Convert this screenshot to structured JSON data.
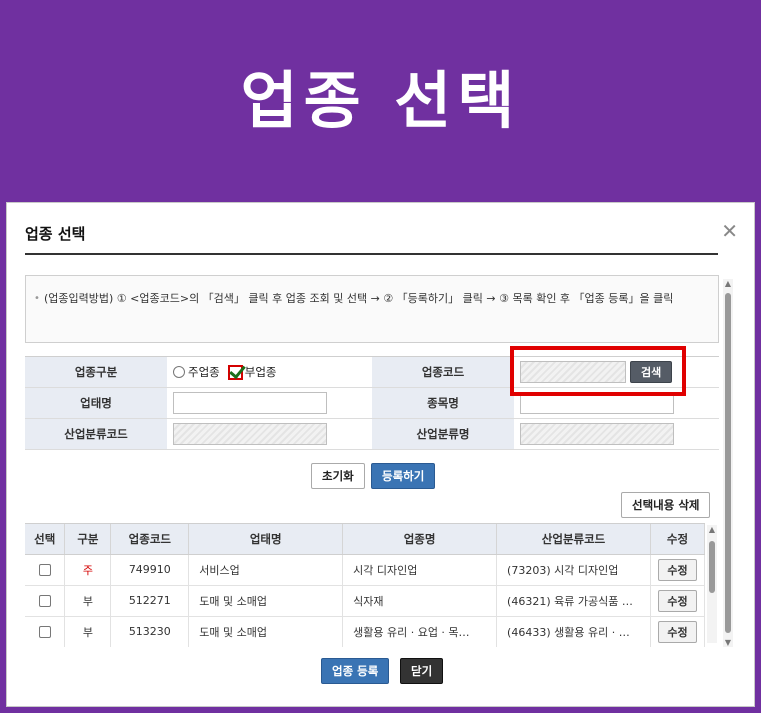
{
  "banner": {
    "title": "업종 선택"
  },
  "dialog": {
    "title": "업종 선택",
    "close_glyph": "✕",
    "guide_text": "(업종입력방법) ① <업종코드>의 「검색」 클릭 후 업종 조회 및 선택 → ② 「등록하기」 클릭 → ③ 목록 확인 후 「업종 등록」을 클릭"
  },
  "form": {
    "type_label": "업종구분",
    "radio_main_label": "주업종",
    "check_sub_label": "부업종",
    "code_label": "업종코드",
    "search_label": "검색",
    "biz_type_label": "업태명",
    "item_label": "종목명",
    "ind_code_label": "산업분류코드",
    "ind_name_label": "산업분류명",
    "code_value": "",
    "biz_type_value": "",
    "item_value": ""
  },
  "actions": {
    "reset_label": "초기화",
    "register_label": "등록하기",
    "delete_selected_label": "선택내용 삭제",
    "submit_label": "업종 등록",
    "close_label": "닫기"
  },
  "table": {
    "headers": [
      "선택",
      "구분",
      "업종코드",
      "업태명",
      "업종명",
      "산업분류코드",
      "수정"
    ],
    "edit_label": "수정",
    "rows": [
      {
        "type": "주",
        "code": "749910",
        "biz": "서비스업",
        "name": "시각 디자인업",
        "ind": "(73203) 시각 디자인업"
      },
      {
        "type": "부",
        "code": "512271",
        "biz": "도매 및 소매업",
        "name": "식자재",
        "ind": "(46321) 육류 가공식품 …"
      },
      {
        "type": "부",
        "code": "513230",
        "biz": "도매 및 소매업",
        "name": "생활용 유리 · 요업 · 목…",
        "ind": "(46433) 생활용 유리 · …"
      }
    ]
  },
  "colors": {
    "banner": "#7030a0",
    "accent_red": "#e00000",
    "button_blue": "#3a74b4"
  }
}
